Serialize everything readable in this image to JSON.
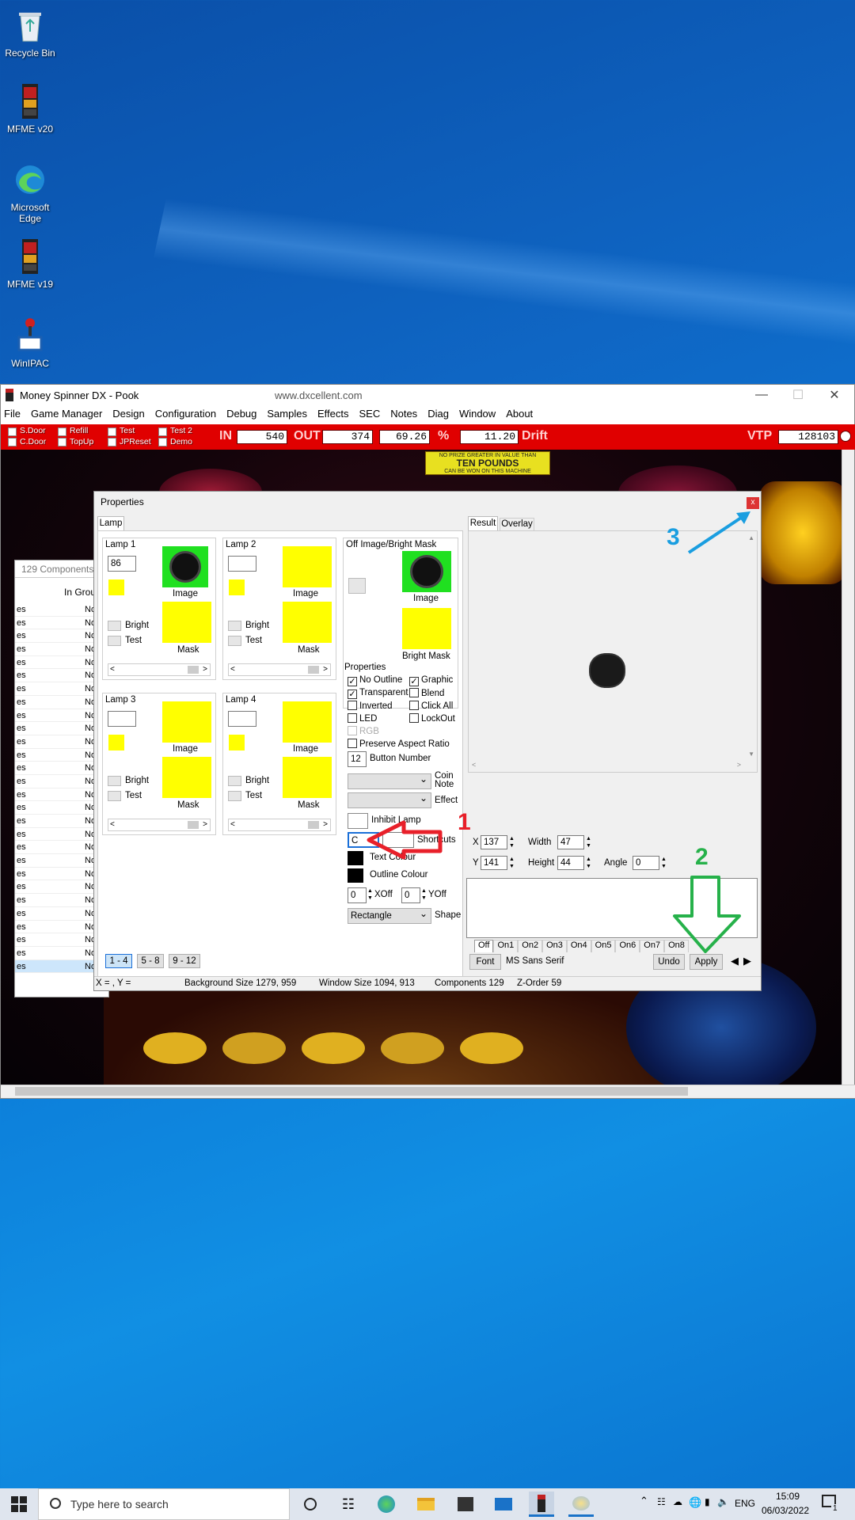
{
  "desktop": {
    "icons": [
      {
        "label": "Recycle Bin"
      },
      {
        "label": "MFME v20"
      },
      {
        "label": "Microsoft Edge"
      },
      {
        "label": "MFME v19"
      },
      {
        "label": "WinIPAC"
      }
    ]
  },
  "window": {
    "title": "Money Spinner DX - Pook",
    "url": "www.dxcellent.com",
    "menu": [
      "File",
      "Game Manager",
      "Design",
      "Configuration",
      "Debug",
      "Samples",
      "Effects",
      "SEC",
      "Notes",
      "Diag",
      "Window",
      "About"
    ],
    "redbar": {
      "checks": [
        "S.Door",
        "Refill",
        "Test",
        "Test 2",
        "C.Door",
        "TopUp",
        "JPReset",
        "Demo"
      ],
      "in_label": "IN",
      "in_value": "540",
      "out_label": "OUT",
      "out_value": "374",
      "pct_value": "69.26",
      "pct_label": "%",
      "drift_value": "11.20",
      "drift_label": "Drift",
      "vtp_label": "VTP",
      "vtp_value": "128103"
    },
    "banner": {
      "line1": "NO PRIZE GREATER IN VALUE THAN",
      "line2": "TEN POUNDS",
      "line3": "CAN BE WON ON THIS MACHINE"
    }
  },
  "components": {
    "header": "129 Components",
    "col2": "In Group",
    "rows_left": "es",
    "rows_right": "No"
  },
  "properties": {
    "title": "Properties",
    "close_label": "x",
    "tab_lamp": "Lamp",
    "lamp1": {
      "title": "Lamp 1",
      "value": "86",
      "image": "Image",
      "mask": "Mask",
      "bright": "Bright",
      "test": "Test"
    },
    "lamp2": {
      "title": "Lamp 2",
      "image": "Image",
      "mask": "Mask",
      "bright": "Bright",
      "test": "Test"
    },
    "lamp3": {
      "title": "Lamp 3",
      "image": "Image",
      "mask": "Mask",
      "bright": "Bright",
      "test": "Test"
    },
    "lamp4": {
      "title": "Lamp 4",
      "image": "Image",
      "mask": "Mask",
      "bright": "Bright",
      "test": "Test"
    },
    "offimage": {
      "title": "Off Image/Bright Mask",
      "image": "Image",
      "bright_mask": "Bright Mask"
    },
    "props": {
      "title": "Properties",
      "no_outline": "No Outline",
      "graphic": "Graphic",
      "transparent": "Transparent",
      "blend": "Blend",
      "inverted": "Inverted",
      "click_all": "Click All",
      "led": "LED",
      "lockout": "LockOut",
      "rgb": "RGB",
      "preserve": "Preserve Aspect Ratio",
      "button_number_value": "12",
      "button_number": "Button Number",
      "coin_note": "Coin Note",
      "effect": "Effect",
      "inhibit_lamp": "Inhibit Lamp",
      "shortcut_value": "C",
      "shortcuts": "Shortcuts",
      "text_colour": "Text Colour",
      "outline_colour": "Outline Colour",
      "xoff_value": "0",
      "xoff": "XOff",
      "yoff_value": "0",
      "yoff": "YOff",
      "shape_value": "Rectangle",
      "shape": "Shape"
    },
    "pages": [
      "1 - 4",
      "5 - 8",
      "9 - 12"
    ],
    "result_tab": "Result",
    "overlay_tab": "Overlay",
    "x_label": "X",
    "x_value": "137",
    "y_label": "Y",
    "y_value": "141",
    "width_label": "Width",
    "width_value": "47",
    "height_label": "Height",
    "height_value": "44",
    "angle_label": "Angle",
    "angle_value": "0",
    "state_tabs": [
      "Off",
      "On1",
      "On2",
      "On3",
      "On4",
      "On5",
      "On6",
      "On7",
      "On8"
    ],
    "font_button": "Font",
    "font_name": "MS Sans Serif",
    "undo": "Undo",
    "apply": "Apply",
    "status": {
      "xy": "X = , Y =",
      "bg": "Background Size 1279, 959",
      "win": "Window Size 1094, 913",
      "comp": "Components 129",
      "z": "Z-Order 59"
    }
  },
  "annotations": {
    "n1": "1",
    "n2": "2",
    "n3": "3",
    "c1": "#e8202a",
    "c2": "#26b14a",
    "c3": "#1a9ee0"
  },
  "taskbar": {
    "search": "Type here to search",
    "lang": "ENG",
    "time": "15:09",
    "date": "06/03/2022",
    "notif": "1"
  }
}
